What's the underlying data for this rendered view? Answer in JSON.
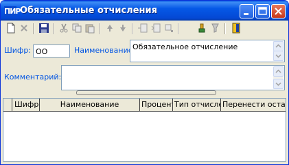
{
  "window": {
    "icon_text": "ПИР",
    "title": "Обязательные отчисления"
  },
  "toolbar": {
    "buttons": [
      {
        "name": "new-record-icon"
      },
      {
        "name": "delete-record-icon"
      },
      {
        "name": "save-icon"
      },
      {
        "name": "cut-icon"
      },
      {
        "name": "copy-icon"
      },
      {
        "name": "paste-icon"
      },
      {
        "name": "move-up-icon"
      },
      {
        "name": "move-down-icon"
      },
      {
        "name": "insert-row-icon"
      },
      {
        "name": "insert-column-icon"
      },
      {
        "name": "delete-row-icon"
      },
      {
        "name": "filter-icon"
      },
      {
        "name": "filter-off-icon"
      },
      {
        "name": "exit-door-icon"
      }
    ]
  },
  "form": {
    "code_label": "Шифр:",
    "code_value": "ОО",
    "name_label": "Наименование:",
    "name_value": "Обязательное отчисление",
    "comment_label": "Комментарий:",
    "comment_value": ""
  },
  "grid": {
    "columns": [
      "Шифр",
      "Наименование",
      "Процент",
      "Тип отчислен",
      "Перенести остато"
    ]
  },
  "colors": {
    "title_bar": "#0558e6",
    "label_blue": "#0054e3",
    "window_bg": "#ece9d8"
  }
}
